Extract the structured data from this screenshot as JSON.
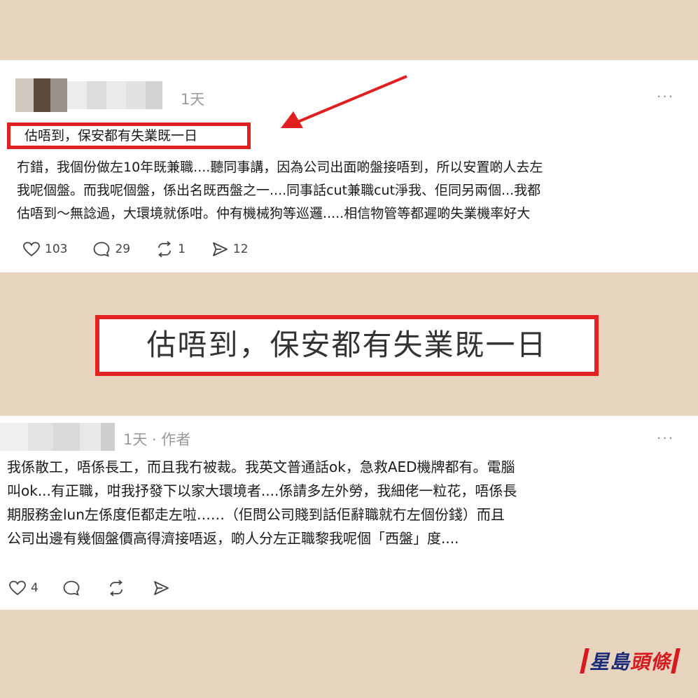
{
  "post1": {
    "time": "1天",
    "more": "···",
    "title": "估唔到，保安都有失業既一日",
    "lines": [
      "冇錯，我個份做左10年既兼職....聽同事講，因為公司出面啲盤接唔到，所以安置啲人去左",
      "我呢個盤。而我呢個盤，係出名既西盤之一....同事話cut兼職cut淨我、佢同另兩個...我都",
      "估唔到～無諗過，大環境就係咁。仲有機械狗等巡邏.....相信物管等都遲啲失業機率好大"
    ],
    "likes": "103",
    "comments": "29",
    "reposts": "1",
    "shares": "12"
  },
  "callout": {
    "text": "估唔到，保安都有失業既一日"
  },
  "post2": {
    "meta": "1天 · 作者",
    "more": "···",
    "lines": [
      "我係散工，唔係長工，而且我冇被裁。我英文普通話ok，急救AED機牌都有。電腦",
      "叫ok...有正職，咁我抒發下以家大環境者....係請多左外勞，我細佬一粒花，唔係長",
      "期服務金lun左係度佢都走左啦……（佢問公司賤到話佢辭職就冇左個份錢）而且",
      "公司出邊有幾個盤價高得濟接唔返，啲人分左正職黎我呢個「西盤」度...."
    ],
    "likes": "4"
  },
  "brand": {
    "part1": "星島",
    "part2": "頭條"
  },
  "colors": {
    "background": "#e6d4bf",
    "highlight": "#e02020",
    "brand_red": "#d71920",
    "brand_blue": "#1d2c78"
  }
}
